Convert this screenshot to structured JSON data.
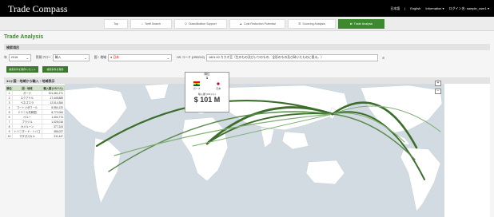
{
  "header": {
    "logo": "Trade Compass",
    "lang_ja": "日本語",
    "lang_sep": "|",
    "lang_en": "English",
    "information": "Information ▾",
    "login": "ログイン名: sample_user1 ▾"
  },
  "tabs": [
    {
      "label": "Top"
    },
    {
      "label": "Tariff Search"
    },
    {
      "label": "Classification Support"
    },
    {
      "label": "Cost Reduction Potential"
    },
    {
      "label": "Sourcing Analysis"
    },
    {
      "label": "Trade Analysis"
    }
  ],
  "page": {
    "title": "Trade Analysis",
    "filter_header": "検索項目",
    "year_label": "年",
    "year_value": "2016",
    "flow_label": "貿易フロー",
    "flow_value": "輸入",
    "country_label": "国・地域",
    "country_value": "● 日本",
    "hs_label": "HS コード (HS2012)",
    "hs_value": "1801.00 カカオ豆（生のもの及びいりのもの、全形のもの及び砕いたものに限る。）",
    "btn1": "検索条件を保存/リセット",
    "btn2": "検索条件を保存",
    "panel_header": "34ヶ国・地域から輸入・地域表示"
  },
  "table": {
    "headers": [
      "順位",
      "国・地域",
      "輸入額 (USドル)"
    ],
    "rows": [
      [
        "1",
        "ガーナ",
        "101,461,271"
      ],
      [
        "2",
        "エクアドル",
        "17,445,889"
      ],
      [
        "3",
        "ベネズエラ",
        "12,014,384"
      ],
      [
        "4",
        "コートジボワール",
        "8,984,120"
      ],
      [
        "5",
        "ドミニカ共和国",
        "8,772,064"
      ],
      [
        "6",
        "ペルー",
        "1,404,774"
      ],
      [
        "7",
        "ブラジル",
        "1,029,016"
      ],
      [
        "8",
        "カメルーン",
        "377,324"
      ],
      [
        "9",
        "トリニダード・トバゴ",
        "356,027"
      ],
      [
        "10",
        "マダガスカル",
        "211,447"
      ]
    ]
  },
  "tooltip": {
    "rank_label": "順位",
    "rank": "1",
    "from": "ガーナ",
    "to": "日本",
    "value_label": "輸入額 (USドル)",
    "value": "$ 101 M"
  },
  "map_controls": {
    "zoom_in": "+",
    "zoom_out": "−"
  },
  "colors": {
    "brand_green": "#3d8a2e",
    "flow_dark": "#3a6e2a",
    "flow_light": "#7fae73",
    "land": "#ffffff",
    "sea": "#d3dbe2",
    "ghana_red": "#ce1126",
    "ghana_gold": "#fcd116",
    "ghana_green": "#006b3f",
    "japan_red": "#bc002d"
  }
}
